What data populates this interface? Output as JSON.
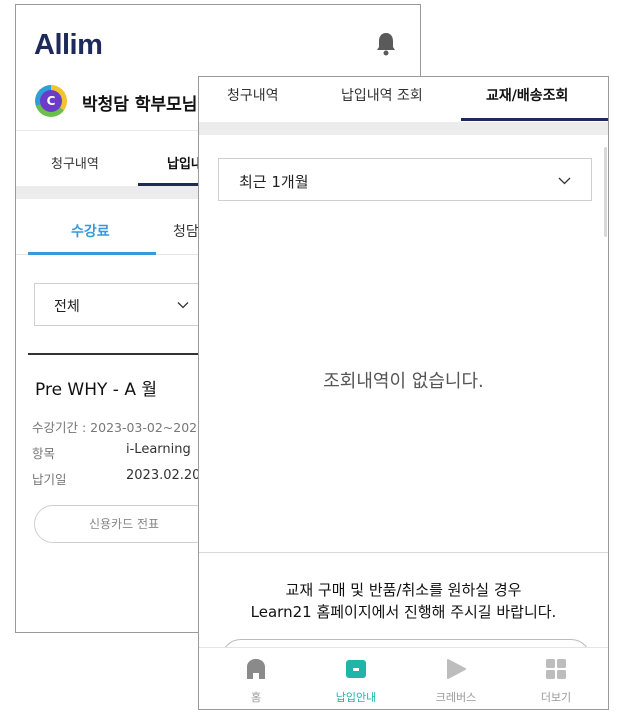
{
  "back_screen": {
    "logo": "Allim",
    "user_name": "박청담 학부모님",
    "user_initial": "C",
    "tabs": [
      "청구내역",
      "납입내"
    ],
    "sub_tabs": [
      "수강료",
      "청담"
    ],
    "filter_value": "전체",
    "course_title": "Pre WHY - A 월",
    "info": {
      "period_label": "수강기간 : 2023-03-02~202",
      "item_label": "항목",
      "item_value": "i-Learning",
      "paid_label": "납기일",
      "paid_value": "2023.02.20"
    },
    "card_receipt_button": "신용카드 전표"
  },
  "front_screen": {
    "tabs": [
      "청구내역",
      "납입내역 조회",
      "교재/배송조회"
    ],
    "period_select": "최근 1개월",
    "empty_message": "조회내역이 없습니다.",
    "notice_line1": "교재 구매 및 반품/취소를 원하실 경우",
    "notice_line2": "Learn21 홈페이지에서 진행해 주시길 바랍니다.",
    "nav": [
      {
        "label": "홈",
        "icon": "home-icon"
      },
      {
        "label": "납입안내",
        "icon": "payment-icon"
      },
      {
        "label": "크레버스",
        "icon": "play-icon"
      },
      {
        "label": "더보기",
        "icon": "grid-icon"
      }
    ]
  },
  "colors": {
    "brand_navy": "#1d2a5b",
    "accent_blue": "#3a9ad9",
    "active_teal": "#1fb5a8"
  }
}
